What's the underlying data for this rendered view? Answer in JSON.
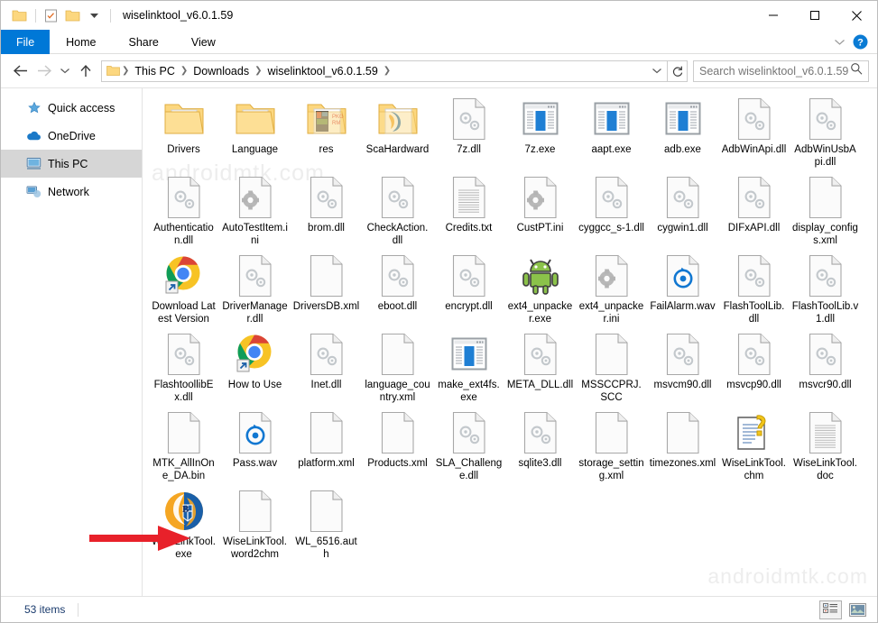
{
  "window": {
    "title": "wiselinktool_v6.0.1.59",
    "quick_access_icons": [
      "folder-icon",
      "properties-icon",
      "new-folder-icon",
      "customize-chevron-icon"
    ],
    "caption": {
      "minimize": "minimize-icon",
      "maximize": "maximize-icon",
      "close": "close-icon"
    }
  },
  "ribbon": {
    "tabs": [
      {
        "label": "File",
        "active": true
      },
      {
        "label": "Home",
        "active": false
      },
      {
        "label": "Share",
        "active": false
      },
      {
        "label": "View",
        "active": false
      }
    ],
    "collapse_icon": "chevron-down-icon",
    "help_icon": "help-icon"
  },
  "address": {
    "back_icon": "arrow-left-icon",
    "forward_icon": "arrow-right-icon",
    "recent_icon": "chevron-down-icon",
    "up_icon": "arrow-up-icon",
    "breadcrumbs": [
      "This PC",
      "Downloads",
      "wiselinktool_v6.0.1.59"
    ],
    "dropdown_icon": "chevron-down-icon",
    "refresh_icon": "refresh-icon"
  },
  "search": {
    "placeholder": "Search wiselinktool_v6.0.1.59",
    "value": "",
    "icon": "search-icon"
  },
  "sidebar": {
    "items": [
      {
        "label": "Quick access",
        "icon": "star-pin-icon",
        "selected": false
      },
      {
        "label": "OneDrive",
        "icon": "cloud-icon",
        "selected": false
      },
      {
        "label": "This PC",
        "icon": "computer-icon",
        "selected": true
      },
      {
        "label": "Network",
        "icon": "network-icon",
        "selected": false
      }
    ]
  },
  "files": [
    {
      "name": "Drivers",
      "icon": "folder-docs"
    },
    {
      "name": "Language",
      "icon": "folder-plain"
    },
    {
      "name": "res",
      "icon": "folder-images"
    },
    {
      "name": "ScaHardward",
      "icon": "folder-blue"
    },
    {
      "name": "7z.dll",
      "icon": "dll"
    },
    {
      "name": "7z.exe",
      "icon": "exe"
    },
    {
      "name": "aapt.exe",
      "icon": "exe"
    },
    {
      "name": "adb.exe",
      "icon": "exe"
    },
    {
      "name": "AdbWinApi.dll",
      "icon": "dll"
    },
    {
      "name": "AdbWinUsbApi.dll",
      "icon": "dll"
    },
    {
      "name": "Authentication.dll",
      "icon": "dll"
    },
    {
      "name": "AutoTestItem.ini",
      "icon": "ini"
    },
    {
      "name": "brom.dll",
      "icon": "dll"
    },
    {
      "name": "CheckAction.dll",
      "icon": "dll"
    },
    {
      "name": "Credits.txt",
      "icon": "txt"
    },
    {
      "name": "CustPT.ini",
      "icon": "ini"
    },
    {
      "name": "cyggcc_s-1.dll",
      "icon": "dll"
    },
    {
      "name": "cygwin1.dll",
      "icon": "dll"
    },
    {
      "name": "DIFxAPI.dll",
      "icon": "dll"
    },
    {
      "name": "display_configs.xml",
      "icon": "blank"
    },
    {
      "name": "Download Latest Version",
      "icon": "chrome-shortcut"
    },
    {
      "name": "DriverManager.dll",
      "icon": "dll"
    },
    {
      "name": "DriversDB.xml",
      "icon": "blank"
    },
    {
      "name": "eboot.dll",
      "icon": "dll"
    },
    {
      "name": "encrypt.dll",
      "icon": "dll"
    },
    {
      "name": "ext4_unpacker.exe",
      "icon": "android"
    },
    {
      "name": "ext4_unpacker.ini",
      "icon": "ini"
    },
    {
      "name": "FailAlarm.wav",
      "icon": "wav"
    },
    {
      "name": "FlashToolLib.dll",
      "icon": "dll"
    },
    {
      "name": "FlashToolLib.v1.dll",
      "icon": "dll"
    },
    {
      "name": "FlashtoollibEx.dll",
      "icon": "dll"
    },
    {
      "name": "How to Use",
      "icon": "chrome-shortcut"
    },
    {
      "name": "Inet.dll",
      "icon": "dll"
    },
    {
      "name": "language_country.xml",
      "icon": "blank"
    },
    {
      "name": "make_ext4fs.exe",
      "icon": "exe"
    },
    {
      "name": "META_DLL.dll",
      "icon": "dll"
    },
    {
      "name": "MSSCCPRJ.SCC",
      "icon": "blank"
    },
    {
      "name": "msvcm90.dll",
      "icon": "dll"
    },
    {
      "name": "msvcp90.dll",
      "icon": "dll"
    },
    {
      "name": "msvcr90.dll",
      "icon": "dll"
    },
    {
      "name": "MTK_AllInOne_DA.bin",
      "icon": "blank"
    },
    {
      "name": "Pass.wav",
      "icon": "wav"
    },
    {
      "name": "platform.xml",
      "icon": "blank"
    },
    {
      "name": "Products.xml",
      "icon": "blank"
    },
    {
      "name": "SLA_Challenge.dll",
      "icon": "dll"
    },
    {
      "name": "sqlite3.dll",
      "icon": "dll"
    },
    {
      "name": "storage_setting.xml",
      "icon": "blank"
    },
    {
      "name": "timezones.xml",
      "icon": "blank"
    },
    {
      "name": "WiseLinkTool.chm",
      "icon": "chm"
    },
    {
      "name": "WiseLinkTool.doc",
      "icon": "txt"
    },
    {
      "name": "WiseLinkTool.exe",
      "icon": "wiselink"
    },
    {
      "name": "WiseLinkTool.word2chm",
      "icon": "blank"
    },
    {
      "name": "WL_6516.auth",
      "icon": "blank"
    }
  ],
  "annotation": {
    "arrow": "red-arrow-pointing-right",
    "color": "#e8212a",
    "target": "WiseLinkTool.exe"
  },
  "watermarks": [
    "androidmtk.com",
    "androidmtk.com"
  ],
  "statusbar": {
    "item_count": "53 items",
    "views": [
      {
        "name": "details-view",
        "active": true
      },
      {
        "name": "large-icons-view",
        "active": false
      }
    ]
  }
}
